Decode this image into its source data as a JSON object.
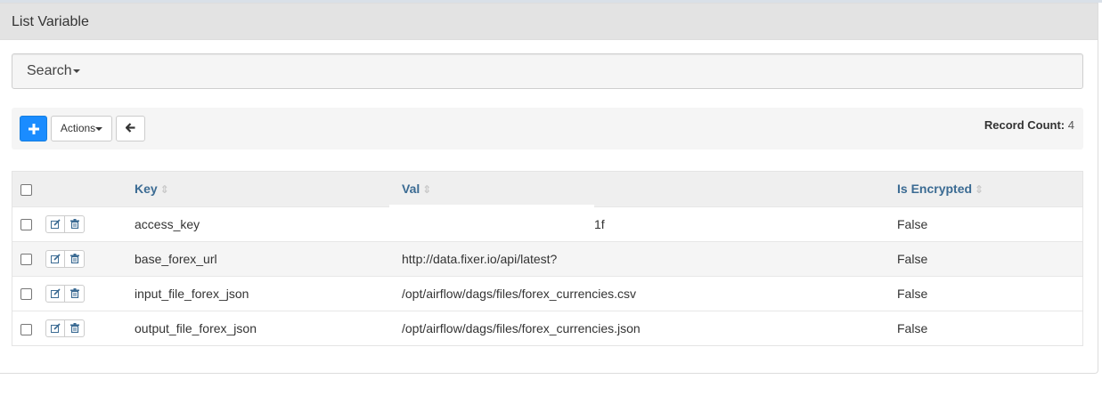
{
  "panel": {
    "title": "List Variable"
  },
  "search": {
    "label": "Search"
  },
  "toolbar": {
    "add_icon": "plus-icon",
    "actions_label": "Actions",
    "back_icon": "arrow-left-icon",
    "record_count_label": "Record Count:",
    "record_count_value": "4"
  },
  "table": {
    "columns": [
      "Key",
      "Val",
      "Is Encrypted"
    ],
    "rows": [
      {
        "key": "access_key",
        "val": "1f",
        "is_encrypted": "False"
      },
      {
        "key": "base_forex_url",
        "val": "http://data.fixer.io/api/latest?",
        "is_encrypted": "False"
      },
      {
        "key": "input_file_forex_json",
        "val": "/opt/airflow/dags/files/forex_currencies.csv",
        "is_encrypted": "False"
      },
      {
        "key": "output_file_forex_json",
        "val": "/opt/airflow/dags/files/forex_currencies.json",
        "is_encrypted": "False"
      }
    ]
  },
  "colors": {
    "primary": "#1a8cff",
    "header_text": "#3b6b93"
  }
}
